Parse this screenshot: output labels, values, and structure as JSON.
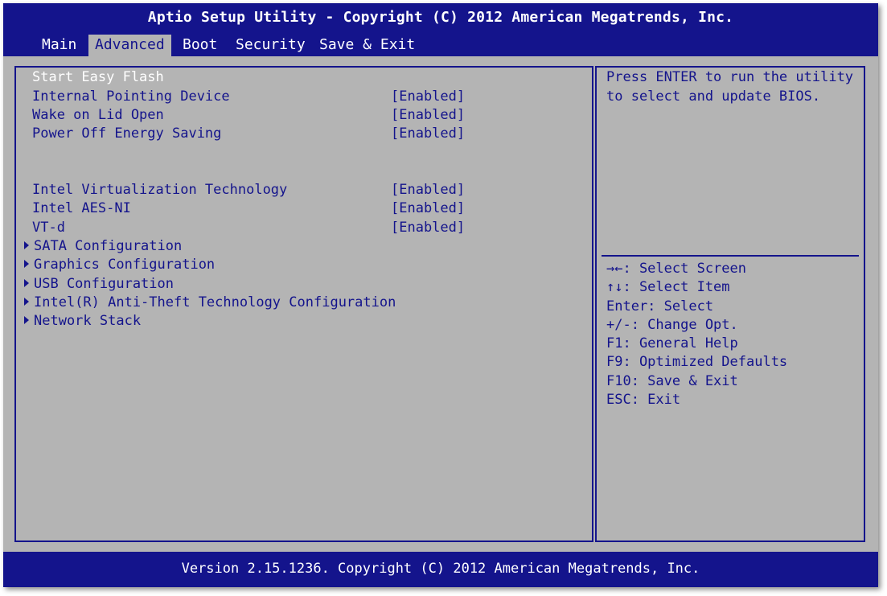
{
  "header": {
    "title": "Aptio Setup Utility - Copyright (C) 2012 American Megatrends, Inc."
  },
  "tabs": [
    {
      "label": "Main"
    },
    {
      "label": "Advanced",
      "active": true
    },
    {
      "label": "Boot"
    },
    {
      "label": "Security"
    },
    {
      "label": "Save & Exit"
    }
  ],
  "menu": {
    "start_easy_flash": "Start Easy Flash",
    "items": [
      {
        "label": "Internal Pointing Device",
        "value": "[Enabled]"
      },
      {
        "label": "Wake on Lid Open",
        "value": "[Enabled]"
      },
      {
        "label": "Power Off Energy Saving",
        "value": "[Enabled]"
      },
      {
        "label": "Intel Virtualization Technology",
        "value": "[Enabled]"
      },
      {
        "label": "Intel AES-NI",
        "value": "[Enabled]"
      },
      {
        "label": "VT-d",
        "value": "[Enabled]"
      }
    ],
    "submenus": [
      {
        "label": "SATA Configuration"
      },
      {
        "label": "Graphics Configuration"
      },
      {
        "label": "USB Configuration"
      },
      {
        "label": "Intel(R) Anti-Theft Technology Configuration"
      },
      {
        "label": "Network Stack"
      }
    ]
  },
  "help": {
    "description": [
      "Press ENTER to run the utility",
      "to select and update BIOS."
    ],
    "keys": [
      "→←: Select Screen",
      "↑↓: Select Item",
      "Enter: Select",
      "+/-: Change Opt.",
      "F1: General Help",
      "F9: Optimized Defaults",
      "F10: Save & Exit",
      "ESC: Exit"
    ]
  },
  "footer": {
    "version": "Version 2.15.1236. Copyright (C) 2012 American Megatrends, Inc."
  },
  "colors": {
    "bar_blue": "#14148c",
    "panel_gray": "#b4b4b4",
    "selected_text": "#ffffff"
  }
}
